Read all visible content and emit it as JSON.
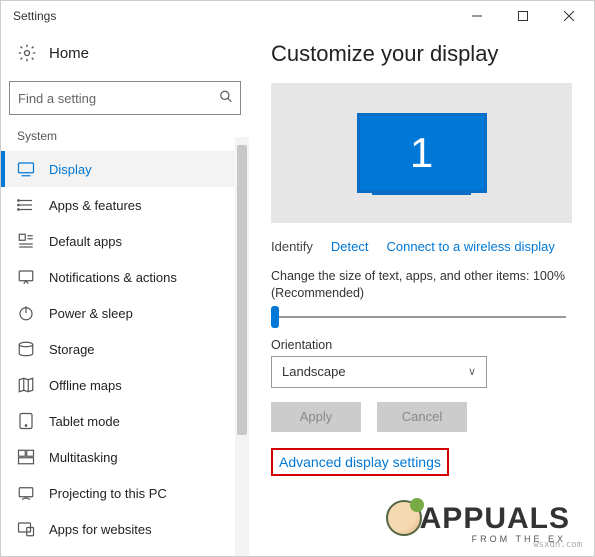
{
  "window": {
    "title": "Settings"
  },
  "left": {
    "home_label": "Home",
    "search_placeholder": "Find a setting",
    "section_label": "System",
    "items": [
      {
        "label": "Display"
      },
      {
        "label": "Apps & features"
      },
      {
        "label": "Default apps"
      },
      {
        "label": "Notifications & actions"
      },
      {
        "label": "Power & sleep"
      },
      {
        "label": "Storage"
      },
      {
        "label": "Offline maps"
      },
      {
        "label": "Tablet mode"
      },
      {
        "label": "Multitasking"
      },
      {
        "label": "Projecting to this PC"
      },
      {
        "label": "Apps for websites"
      }
    ]
  },
  "right": {
    "heading": "Customize your display",
    "monitor_number": "1",
    "identify_label": "Identify",
    "detect_label": "Detect",
    "connect_label": "Connect to a wireless display",
    "scale_text": "Change the size of text, apps, and other items: 100% (Recommended)",
    "orientation_label": "Orientation",
    "orientation_value": "Landscape",
    "apply_label": "Apply",
    "cancel_label": "Cancel",
    "advanced_label": "Advanced display settings"
  },
  "watermark": {
    "site": "wsxdn.com",
    "brand": "APPUALS",
    "tagline": "FROM THE EX"
  }
}
